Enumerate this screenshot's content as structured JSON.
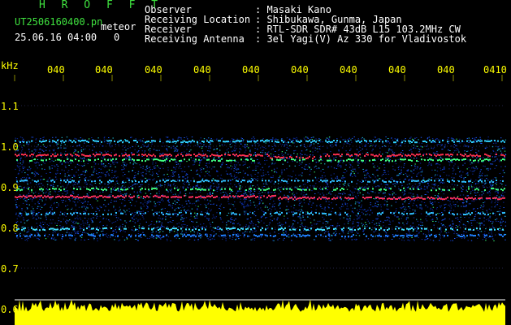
{
  "app": {
    "title": "H R O F F T"
  },
  "file": {
    "name": "UT2506160400.pn",
    "suffix": "meteor",
    "timestamp": "25.06.16 04:00",
    "count": "0"
  },
  "info": [
    {
      "label": "Observer",
      "value": ": Masaki Kano"
    },
    {
      "label": "Receiving Location",
      "value": ": Shibukawa, Gunma, Japan"
    },
    {
      "label": "Receiver",
      "value": ": RTL-SDR SDR# 43dB L15 103.2MHz CW"
    },
    {
      "label": "Receiving Antenna",
      "value": ": 3el Yagi(V) Az 330 for Vladivostok"
    }
  ],
  "axis": {
    "unit": "kHz",
    "y_ticks": [
      "1.1",
      "1.0",
      "0.9",
      "0.8",
      "0.7",
      "0.6"
    ],
    "x_ticks": [
      "040",
      "040",
      "040",
      "040",
      "040",
      "040",
      "040",
      "040",
      "040",
      "0410"
    ]
  },
  "colors": {
    "background": "#000000",
    "text": "#ffffff",
    "title": "#3fe23f",
    "axis": "#ffff00",
    "noise": "#ffff00"
  }
}
